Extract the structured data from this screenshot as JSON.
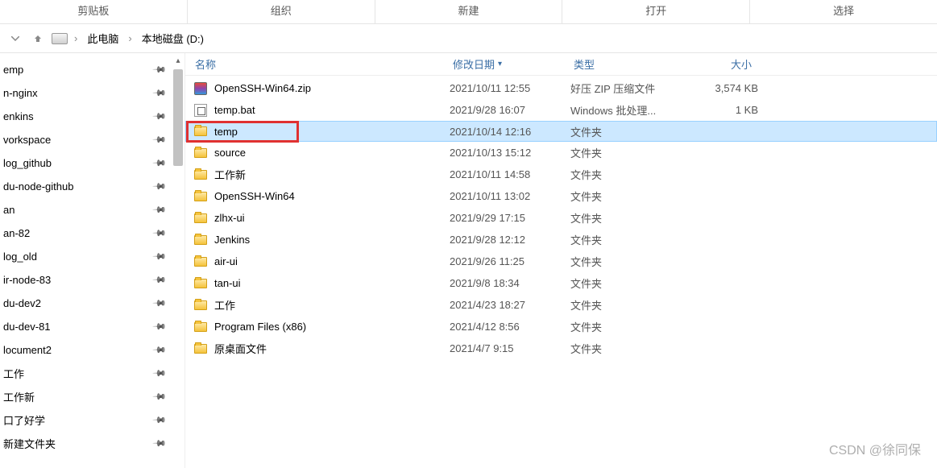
{
  "ribbon": {
    "groups": [
      "剪贴板",
      "组织",
      "新建",
      "打开",
      "选择"
    ]
  },
  "breadcrumb": {
    "items": [
      "此电脑",
      "本地磁盘 (D:)"
    ]
  },
  "columns": {
    "name": "名称",
    "date": "修改日期",
    "type": "类型",
    "size": "大小"
  },
  "sidebar": {
    "items": [
      {
        "label": "emp"
      },
      {
        "label": "n-nginx"
      },
      {
        "label": "enkins"
      },
      {
        "label": "vorkspace"
      },
      {
        "label": "log_github"
      },
      {
        "label": "du-node-github"
      },
      {
        "label": "an"
      },
      {
        "label": "an-82"
      },
      {
        "label": "log_old"
      },
      {
        "label": "ir-node-83"
      },
      {
        "label": "du-dev2"
      },
      {
        "label": "du-dev-81"
      },
      {
        "label": "locument2"
      },
      {
        "label": "工作"
      },
      {
        "label": "工作新"
      },
      {
        "label": "口了好学"
      },
      {
        "label": "新建文件夹"
      }
    ]
  },
  "files": [
    {
      "icon": "zip",
      "name": "OpenSSH-Win64.zip",
      "date": "2021/10/11 12:55",
      "type": "好压 ZIP 压缩文件",
      "size": "3,574 KB"
    },
    {
      "icon": "bat",
      "name": "temp.bat",
      "date": "2021/9/28 16:07",
      "type": "Windows 批处理...",
      "size": "1 KB"
    },
    {
      "icon": "folder",
      "name": "temp",
      "date": "2021/10/14 12:16",
      "type": "文件夹",
      "size": "",
      "selected": true,
      "highlight": true
    },
    {
      "icon": "folder",
      "name": "source",
      "date": "2021/10/13 15:12",
      "type": "文件夹",
      "size": ""
    },
    {
      "icon": "folder",
      "name": "工作新",
      "date": "2021/10/11 14:58",
      "type": "文件夹",
      "size": ""
    },
    {
      "icon": "folder",
      "name": "OpenSSH-Win64",
      "date": "2021/10/11 13:02",
      "type": "文件夹",
      "size": ""
    },
    {
      "icon": "folder",
      "name": "zlhx-ui",
      "date": "2021/9/29 17:15",
      "type": "文件夹",
      "size": ""
    },
    {
      "icon": "folder",
      "name": "Jenkins",
      "date": "2021/9/28 12:12",
      "type": "文件夹",
      "size": ""
    },
    {
      "icon": "folder",
      "name": "air-ui",
      "date": "2021/9/26 11:25",
      "type": "文件夹",
      "size": ""
    },
    {
      "icon": "folder",
      "name": "tan-ui",
      "date": "2021/9/8 18:34",
      "type": "文件夹",
      "size": ""
    },
    {
      "icon": "folder",
      "name": "工作",
      "date": "2021/4/23 18:27",
      "type": "文件夹",
      "size": ""
    },
    {
      "icon": "folder",
      "name": "Program Files (x86)",
      "date": "2021/4/12 8:56",
      "type": "文件夹",
      "size": ""
    },
    {
      "icon": "folder",
      "name": "原桌面文件",
      "date": "2021/4/7 9:15",
      "type": "文件夹",
      "size": ""
    }
  ],
  "watermark": "CSDN @徐同保"
}
